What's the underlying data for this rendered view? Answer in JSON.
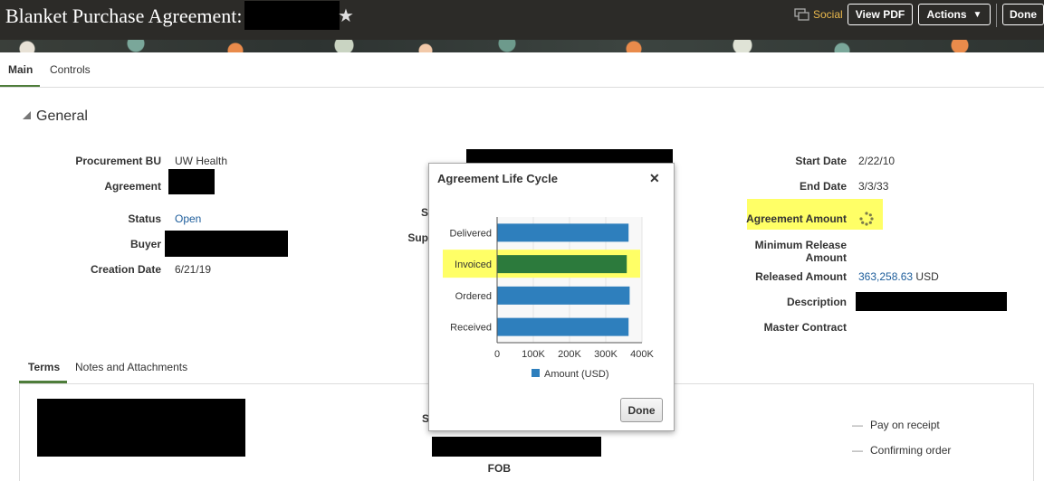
{
  "header": {
    "title": "Blanket Purchase Agreement:",
    "social_label": "Social",
    "view_pdf_label": "View PDF",
    "actions_label": "Actions",
    "done_label": "Done",
    "star_glyph": "★",
    "caret_glyph": "▼"
  },
  "tabs": {
    "main": "Main",
    "controls": "Controls"
  },
  "general": {
    "title": "General",
    "procurement_bu_label": "Procurement BU",
    "procurement_bu_value": "UW Health",
    "agreement_label": "Agreement",
    "status_label": "Status",
    "status_value": "Open",
    "buyer_label": "Buyer",
    "creation_date_label": "Creation Date",
    "creation_date_value": "6/21/19",
    "start_date_label": "Start Date",
    "start_date_value": "2/22/10",
    "end_date_label": "End Date",
    "end_date_value": "3/3/33",
    "agreement_amount_label": "Agreement Amount",
    "min_release_label_1": "Minimum Release",
    "min_release_label_2": "Amount",
    "released_amount_label": "Released Amount",
    "released_amount_value": "363,258.63",
    "released_amount_currency": "USD",
    "description_label": "Description",
    "master_contract_label": "Master Contract",
    "partial_s": "S",
    "partial_sup": "Sup",
    "partial_s2": "S",
    "fob_label": "FOB"
  },
  "subtabs": {
    "terms": "Terms",
    "notes": "Notes and Attachments"
  },
  "bottom": {
    "pay_on_receipt": "Pay on receipt",
    "confirming_order": "Confirming order",
    "dash": "—"
  },
  "dialog": {
    "title": "Agreement Life Cycle",
    "close": "✕",
    "done_label": "Done"
  },
  "colors": {
    "bar": "#2e7fbd",
    "highlight_bar": "#2c7a3c",
    "highlight": "#ffff66"
  },
  "chart_data": {
    "type": "bar",
    "orientation": "horizontal",
    "categories": [
      "Delivered",
      "Invoiced",
      "Ordered",
      "Received"
    ],
    "series": [
      {
        "name": "Amount (USD)",
        "values": [
          363000,
          358000,
          366000,
          363000
        ]
      }
    ],
    "highlighted_category": "Invoiced",
    "x_ticks": [
      "0",
      "100K",
      "200K",
      "300K",
      "400K"
    ],
    "xlim": [
      0,
      400000
    ],
    "grid": true,
    "legend": "bottom"
  }
}
